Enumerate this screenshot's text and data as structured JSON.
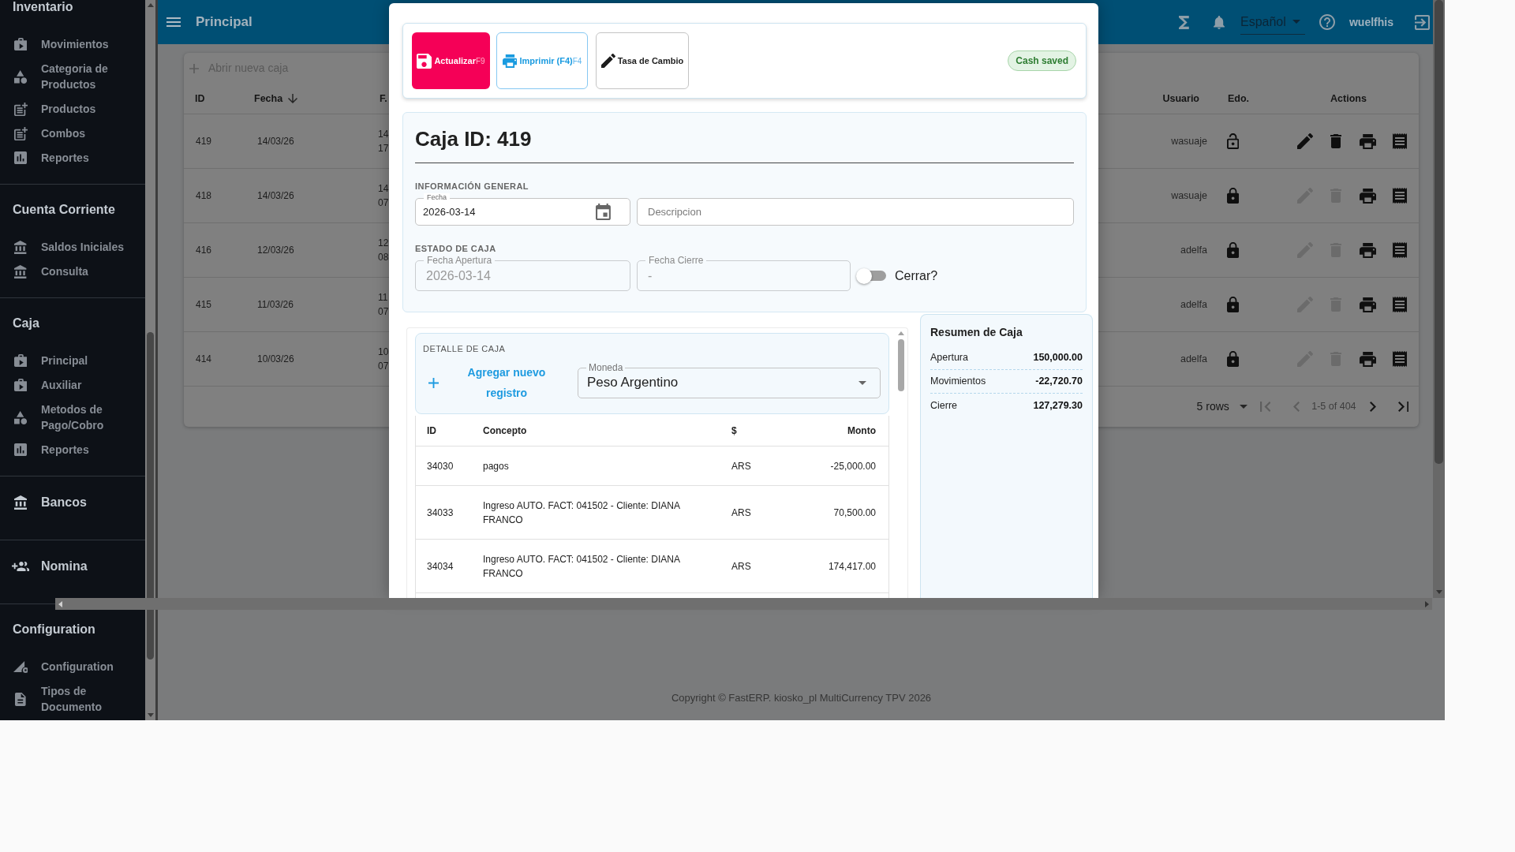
{
  "sidebar": {
    "sections": [
      {
        "kind": "group",
        "title": "Inventario",
        "items": [
          {
            "label": "Movimientos"
          },
          {
            "label": "Categoria de Productos"
          },
          {
            "label": "Productos"
          },
          {
            "label": "Combos"
          },
          {
            "label": "Reportes"
          }
        ]
      },
      {
        "kind": "group",
        "title": "Cuenta Corriente",
        "items": [
          {
            "label": "Saldos Iniciales"
          },
          {
            "label": "Consulta"
          }
        ]
      },
      {
        "kind": "group",
        "title": "Caja",
        "items": [
          {
            "label": "Principal"
          },
          {
            "label": "Auxiliar"
          },
          {
            "label": "Metodos de Pago/Cobro"
          },
          {
            "label": "Reportes"
          }
        ]
      },
      {
        "kind": "link",
        "label": "Bancos"
      },
      {
        "kind": "link",
        "label": "Nomina"
      },
      {
        "kind": "group",
        "title": "Configuration",
        "items": [
          {
            "label": "Configuration"
          },
          {
            "label": "Tipos de Documento"
          }
        ]
      }
    ]
  },
  "header": {
    "title": "Principal",
    "language": "Español",
    "user": "wuelfhis"
  },
  "cash_registers": {
    "new_button": "Abrir nueva caja",
    "columns": [
      {
        "label": "ID",
        "sorted": false
      },
      {
        "label": "Fecha",
        "sorted": true
      },
      {
        "label": "F.",
        "sorted": false
      },
      {
        "label": "Usuario",
        "sorted": false
      },
      {
        "label": "Edo.",
        "sorted": false
      },
      {
        "label": "Actions",
        "sorted": false
      }
    ],
    "rows": [
      {
        "id": "419",
        "fecha": "14/03/26",
        "column_3": [
          "14",
          "17"
        ],
        "usuario": "wasuaje",
        "closed": false
      },
      {
        "id": "418",
        "fecha": "14/03/26",
        "column_3": [
          "14",
          "07"
        ],
        "usuario": "wasuaje",
        "closed": true
      },
      {
        "id": "416",
        "fecha": "12/03/26",
        "column_3": [
          "12",
          "08"
        ],
        "usuario": "adelfa",
        "closed": true
      },
      {
        "id": "415",
        "fecha": "11/03/26",
        "column_3": [
          "11",
          "07"
        ],
        "usuario": "adelfa",
        "closed": true
      },
      {
        "id": "414",
        "fecha": "10/03/26",
        "column_3": [
          "10",
          "07"
        ],
        "usuario": "adelfa",
        "closed": true
      }
    ],
    "pagination": {
      "rows_per_page": "5 rows",
      "range": "1-5 of 404",
      "on_first_page": true,
      "on_last_page": false
    }
  },
  "modal": {
    "toolbar": {
      "buttons": [
        {
          "kind": "primary",
          "label": "Actualizar",
          "shortcut": "F9"
        },
        {
          "kind": "outlined",
          "label": "Imprimir (F4)",
          "shortcut": "F4"
        },
        {
          "kind": "plain",
          "label": "Tasa de Cambio"
        }
      ],
      "status": "Cash saved"
    },
    "title": "Caja ID: 419",
    "general": {
      "heading": "INFORMACIÓN GENERAL",
      "fecha": {
        "label": "Fecha",
        "value": "2026-03-14",
        "disabled": false
      },
      "descripcion": {
        "placeholder": "Descripcion",
        "disabled": false
      }
    },
    "status_section": {
      "heading": "ESTADO DE CAJA",
      "apertura": {
        "label": "Fecha Apertura",
        "value": "2026-03-14",
        "disabled": true
      },
      "cierre": {
        "label": "Fecha Cierre",
        "value": "-",
        "disabled": true
      },
      "close_switch": {
        "label": "Cerrar?",
        "on": false
      }
    },
    "detail": {
      "heading": "DETALLE DE CAJA",
      "add_button": "Agregar nuevo registro",
      "currency": {
        "label": "Moneda",
        "value": "Peso Argentino"
      },
      "columns": [
        "ID",
        "Concepto",
        "$",
        "Monto"
      ],
      "rows": [
        {
          "id": "34030",
          "concepto": "pagos",
          "currency": "ARS",
          "monto": "-25,000.00"
        },
        {
          "id": "34033",
          "concepto": "Ingreso AUTO. FACT: 041502 - Cliente: DIANA FRANCO",
          "currency": "ARS",
          "monto": "70,500.00"
        },
        {
          "id": "34034",
          "concepto": "Ingreso AUTO. FACT: 041502 - Cliente: DIANA FRANCO",
          "currency": "ARS",
          "monto": "174,417.00"
        }
      ]
    },
    "summary": {
      "title": "Resumen de Caja",
      "rows": [
        {
          "label": "Apertura",
          "value": "150,000.00"
        },
        {
          "label": "Movimientos",
          "value": "-22,720.70"
        },
        {
          "label": "Cierre",
          "value": "127,279.30"
        }
      ]
    }
  },
  "footer": {
    "copyright": "Copyright © FastERP. kiosko_pl MultiCurrency TPV 2026"
  }
}
